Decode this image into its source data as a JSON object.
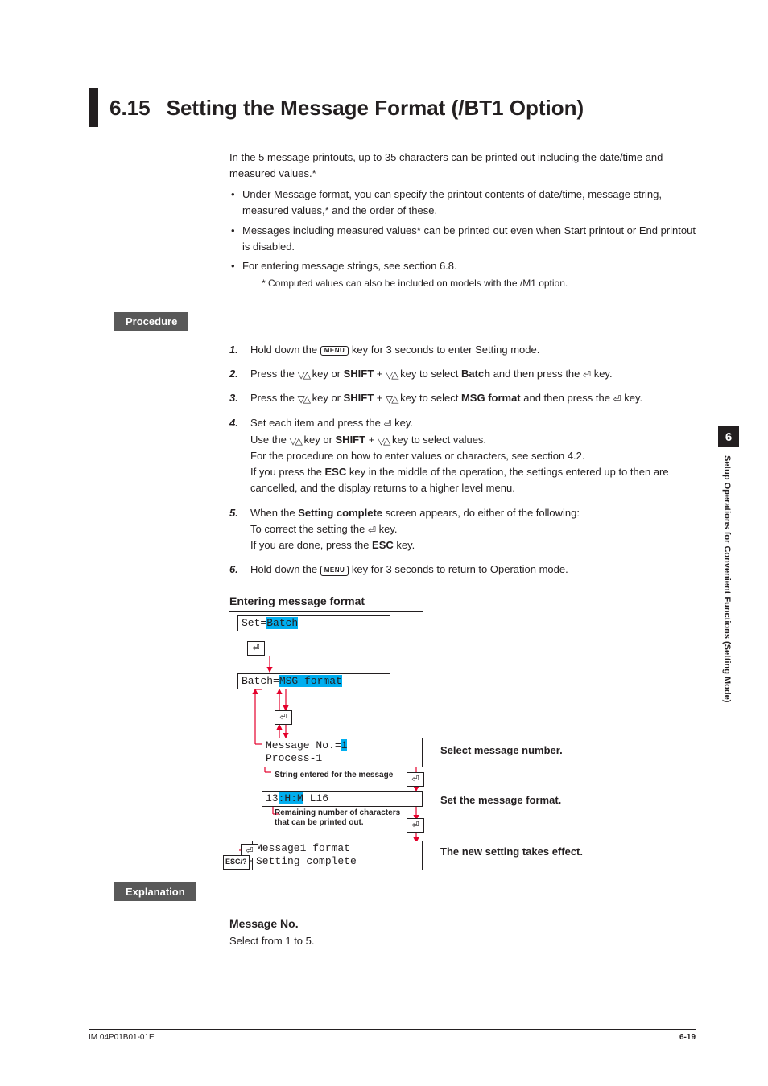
{
  "title": {
    "number": "6.15",
    "text": "Setting the Message Format (/BT1 Option)"
  },
  "intro": {
    "p1": "In the 5 message printouts, up to 35 characters can be printed out including the date/time and measured values.*",
    "b1": "Under Message format, you can specify the printout contents of date/time, message string, measured values,* and the order of these.",
    "b2": "Messages including measured values* can be printed out even when Start printout or End printout is disabled.",
    "b3": "For entering message strings, see section 6.8.",
    "foot": "*   Computed values can also be included on models with the /M1 option."
  },
  "labels": {
    "procedure": "Procedure",
    "explanation": "Explanation",
    "entering": "Entering message format"
  },
  "steps": {
    "s1a": "Hold down the ",
    "s1b": " key for 3 seconds to enter Setting mode.",
    "s2a": "Press the ",
    "s2b": " key or ",
    "s2shift": "SHIFT",
    "s2c": " + ",
    "s2d": " key to select ",
    "s2batch": "Batch",
    "s2e": " and then press the ",
    "s2f": " key.",
    "s3a": "Press the ",
    "s3b": " key or ",
    "s3shift": "SHIFT",
    "s3c": " + ",
    "s3d": " key to select ",
    "s3msg": "MSG format",
    "s3e": " and then press the ",
    "s3f": " key.",
    "s4a": "Set each item and press the ",
    "s4b": " key.",
    "s4c": "Use the ",
    "s4d": " key or ",
    "s4shift": "SHIFT",
    "s4e": " + ",
    "s4f": " key to select values.",
    "s4g": "For the procedure on how to enter values or characters, see section 4.2.",
    "s4h": "If you press the ",
    "s4esc": "ESC",
    "s4i": " key in the middle of the operation, the settings entered up to then are cancelled, and the display returns to a higher level menu.",
    "s5a": "When the ",
    "s5set": "Setting complete",
    "s5b": " screen appears, do either of the following:",
    "s5c": "To correct the setting the ",
    "s5d": " key.",
    "s5e": "If you are done, press the ",
    "s5esc": "ESC",
    "s5f": " key.",
    "s6a": "Hold down the ",
    "s6b": " key for 3 seconds to return to Operation mode."
  },
  "keys": {
    "menu": "MENU"
  },
  "diagram": {
    "lcd1a": "Set=",
    "lcd1b": "Batch",
    "lcd2a": "Batch=",
    "lcd2b": "MSG format",
    "lcd3a": "Message No.=",
    "lcd3b": "1",
    "lcd3c": "Process-1",
    "lcd4a": "13",
    "lcd4b": ":",
    "lcd4c": "H:M",
    "lcd4d": " L16",
    "lcd5a": "Message1 format",
    "lcd5b": "Setting complete",
    "esc": "ESC/?",
    "label_string": "String entered for the message",
    "label_remain": "Remaining number of characters that can be printed out.",
    "cap1": "Select message number.",
    "cap2": "Set the message format.",
    "cap3": "The new setting takes effect."
  },
  "explanation": {
    "h": "Message No.",
    "p": "Select from 1 to 5."
  },
  "sidetab": {
    "num": "6",
    "text": "Setup Operations for Convenient Functions (Setting Mode)"
  },
  "footer": {
    "left": "IM 04P01B01-01E",
    "right": "6-19"
  }
}
